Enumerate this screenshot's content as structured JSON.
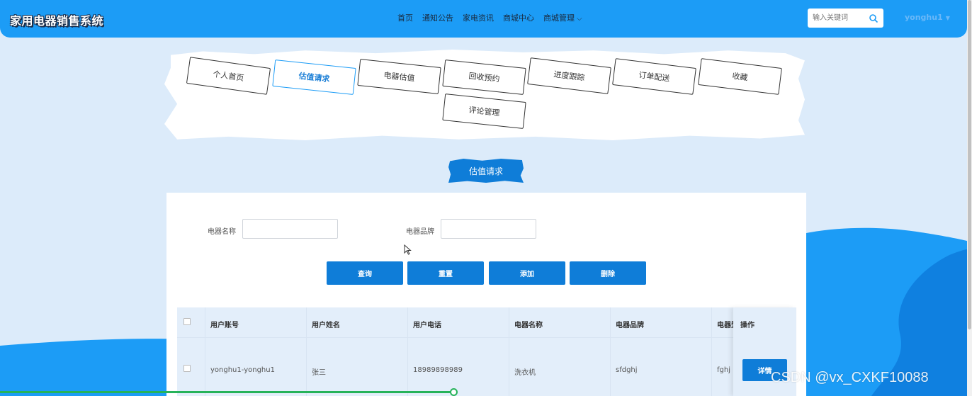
{
  "header": {
    "logo": "家用电器销售系统",
    "nav": [
      "首页",
      "通知公告",
      "家电资讯",
      "商城中心",
      "商城管理"
    ],
    "search_placeholder": "输入关键词",
    "user": "yonghu1"
  },
  "tabs": [
    "个人首页",
    "估值请求",
    "电器估值",
    "回收预约",
    "进度跟踪",
    "订单配送",
    "收藏",
    "评论管理"
  ],
  "active_tab": "估值请求",
  "page_title": "估值请求",
  "filters": {
    "name_label": "电器名称",
    "brand_label": "电器品牌"
  },
  "buttons": {
    "query": "查询",
    "reset": "重置",
    "add": "添加",
    "delete": "删除"
  },
  "table": {
    "headers": [
      "用户账号",
      "用户姓名",
      "用户电话",
      "电器名称",
      "电器品牌",
      "电器型",
      "操作"
    ],
    "rows": [
      [
        "yonghu1-yonghu1",
        "张三",
        "18989898989",
        "洗衣机",
        "sfdghj",
        "fghj"
      ]
    ],
    "detail_label": "详情"
  },
  "watermark": "CSDN @vx_CXKF10088",
  "colors": {
    "header": "#1c9cf6",
    "primary": "#0f7dd8",
    "progress": "#27b35a"
  }
}
